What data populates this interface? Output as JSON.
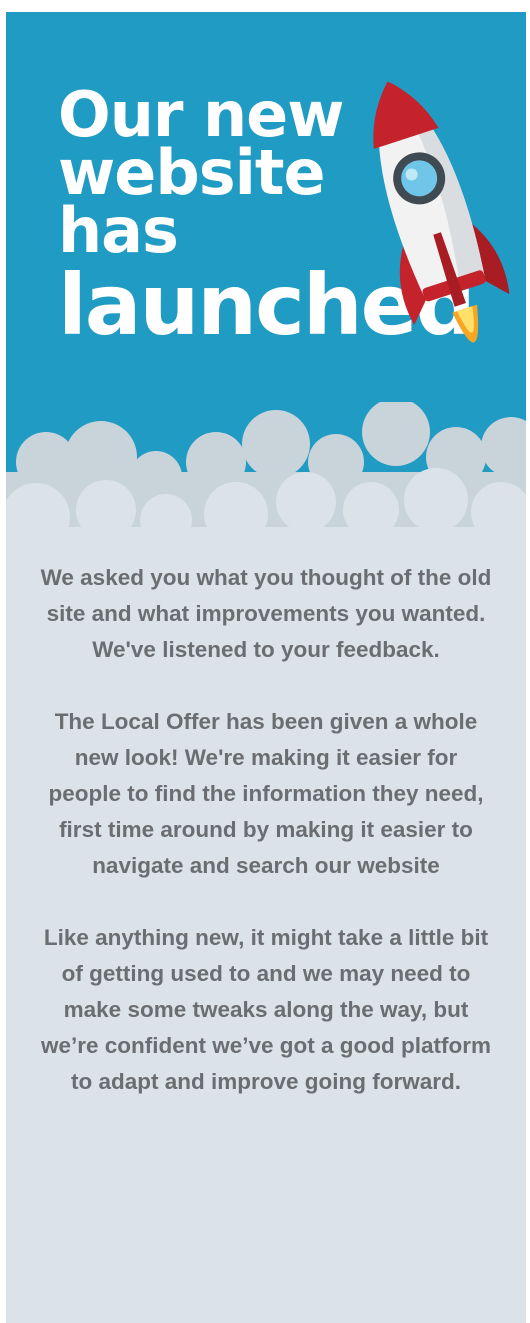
{
  "hero": {
    "headline_lines": [
      "Our new",
      "website",
      "has"
    ],
    "headline_big": "launched",
    "background_color": "#1f9bc4",
    "illustration": "rocket-icon"
  },
  "body": {
    "paragraphs": [
      "We asked you what you thought of the old site and what improvements you wanted. We've listened to your feedback.",
      "The Local Offer has been given a whole new look! We're making it easier for people to find the information they need, first time around by making it easier to navigate and search our website",
      "Like anything new, it might take a little bit of getting used to and we may need to make some tweaks along the way, but we’re confident we’ve got a good platform to adapt and improve going forward."
    ],
    "text_color": "#6b6e70",
    "background_color": "#dbe3e8"
  }
}
